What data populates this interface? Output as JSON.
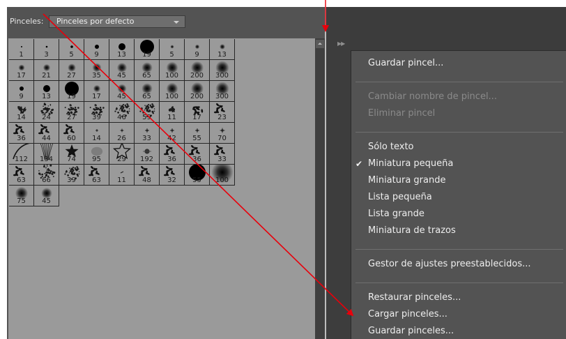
{
  "panel": {
    "label": "Pinceles:",
    "preset_dropdown": "Pinceles por defecto",
    "collapse_icon": "double-chevron-right-icon"
  },
  "brushes": [
    {
      "size": "1",
      "kind": "dot",
      "r": 1
    },
    {
      "size": "3",
      "kind": "dot",
      "r": 1.3
    },
    {
      "size": "5",
      "kind": "dot",
      "r": 1.8
    },
    {
      "size": "9",
      "kind": "dot",
      "r": 3
    },
    {
      "size": "13",
      "kind": "dot",
      "r": 5
    },
    {
      "size": "19",
      "kind": "dot",
      "r": 10
    },
    {
      "size": "5",
      "kind": "soft",
      "r": 2
    },
    {
      "size": "9",
      "kind": "soft",
      "r": 2.5
    },
    {
      "size": "13",
      "kind": "soft",
      "r": 3
    },
    {
      "size": "17",
      "kind": "soft",
      "r": 3.5
    },
    {
      "size": "21",
      "kind": "soft",
      "r": 4
    },
    {
      "size": "27",
      "kind": "soft",
      "r": 4.5
    },
    {
      "size": "35",
      "kind": "soft",
      "r": 5
    },
    {
      "size": "45",
      "kind": "soft",
      "r": 5.5
    },
    {
      "size": "65",
      "kind": "soft",
      "r": 6
    },
    {
      "size": "100",
      "kind": "soft",
      "r": 6.5
    },
    {
      "size": "200",
      "kind": "soft",
      "r": 7
    },
    {
      "size": "300",
      "kind": "soft",
      "r": 7.5
    },
    {
      "size": "9",
      "kind": "dot",
      "r": 3
    },
    {
      "size": "13",
      "kind": "dot",
      "r": 5
    },
    {
      "size": "19",
      "kind": "dot",
      "r": 10
    },
    {
      "size": "17",
      "kind": "soft",
      "r": 4
    },
    {
      "size": "45",
      "kind": "soft",
      "r": 5
    },
    {
      "size": "65",
      "kind": "soft",
      "r": 6
    },
    {
      "size": "100",
      "kind": "soft",
      "r": 6.5
    },
    {
      "size": "200",
      "kind": "soft",
      "r": 7
    },
    {
      "size": "300",
      "kind": "soft",
      "r": 7.5
    },
    {
      "size": "14",
      "kind": "splat",
      "r": 6
    },
    {
      "size": "24",
      "kind": "splat",
      "r": 9
    },
    {
      "size": "27",
      "kind": "splat",
      "r": 10
    },
    {
      "size": "39",
      "kind": "splat",
      "r": 10
    },
    {
      "size": "46",
      "kind": "splat",
      "r": 11
    },
    {
      "size": "59",
      "kind": "splat",
      "r": 11
    },
    {
      "size": "11",
      "kind": "splat",
      "r": 4
    },
    {
      "size": "17",
      "kind": "leafy",
      "r": 8
    },
    {
      "size": "23",
      "kind": "leafy",
      "r": 10
    },
    {
      "size": "36",
      "kind": "leafy",
      "r": 10
    },
    {
      "size": "44",
      "kind": "leafy",
      "r": 10
    },
    {
      "size": "60",
      "kind": "leafy",
      "r": 10
    },
    {
      "size": "14",
      "kind": "star",
      "r": 2
    },
    {
      "size": "26",
      "kind": "star",
      "r": 2.5
    },
    {
      "size": "33",
      "kind": "star",
      "r": 3
    },
    {
      "size": "42",
      "kind": "star",
      "r": 3
    },
    {
      "size": "55",
      "kind": "star",
      "r": 3
    },
    {
      "size": "70",
      "kind": "star",
      "r": 3.5
    },
    {
      "size": "112",
      "kind": "stroke",
      "r": 14
    },
    {
      "size": "134",
      "kind": "grass",
      "r": 14
    },
    {
      "size": "74",
      "kind": "maple",
      "r": 10
    },
    {
      "size": "95",
      "kind": "leaf",
      "r": 9
    },
    {
      "size": "29",
      "kind": "outline-star",
      "r": 12
    },
    {
      "size": "192",
      "kind": "spark",
      "r": 6
    },
    {
      "size": "36",
      "kind": "leafy",
      "r": 10
    },
    {
      "size": "36",
      "kind": "leafy",
      "r": 10
    },
    {
      "size": "33",
      "kind": "leafy",
      "r": 10
    },
    {
      "size": "63",
      "kind": "leafy",
      "r": 10
    },
    {
      "size": "66",
      "kind": "texture",
      "r": 12
    },
    {
      "size": "39",
      "kind": "texture",
      "r": 11
    },
    {
      "size": "63",
      "kind": "leafy",
      "r": 10
    },
    {
      "size": "11",
      "kind": "tiny",
      "r": 1.5
    },
    {
      "size": "48",
      "kind": "leafy",
      "r": 10
    },
    {
      "size": "32",
      "kind": "leafy",
      "r": 10
    },
    {
      "size": "55",
      "kind": "bigdot",
      "r": 12
    },
    {
      "size": "100",
      "kind": "fuzzy",
      "r": 12
    },
    {
      "size": "75",
      "kind": "soft",
      "r": 7
    },
    {
      "size": "45",
      "kind": "soft",
      "r": 6
    }
  ],
  "menu": {
    "items": [
      {
        "label": "Guardar pincel...",
        "enabled": true,
        "checked": false
      },
      {
        "label": "Cambiar nombre de pincel...",
        "enabled": false,
        "checked": false
      },
      {
        "label": "Eliminar pincel",
        "enabled": false,
        "checked": false
      },
      {
        "label": "Sólo texto",
        "enabled": true,
        "checked": false
      },
      {
        "label": "Miniatura pequeña",
        "enabled": true,
        "checked": true
      },
      {
        "label": "Miniatura grande",
        "enabled": true,
        "checked": false
      },
      {
        "label": "Lista pequeña",
        "enabled": true,
        "checked": false
      },
      {
        "label": "Lista grande",
        "enabled": true,
        "checked": false
      },
      {
        "label": "Miniatura de trazos",
        "enabled": true,
        "checked": false
      },
      {
        "label": "Gestor de ajustes preestablecidos...",
        "enabled": true,
        "checked": false
      },
      {
        "label": "Restaurar pinceles...",
        "enabled": true,
        "checked": false
      },
      {
        "label": "Cargar pinceles...",
        "enabled": true,
        "checked": false
      },
      {
        "label": "Guardar pinceles...",
        "enabled": true,
        "checked": false
      }
    ],
    "check_icon": "check-icon"
  },
  "annotations": {
    "color": "#e8000b"
  },
  "colors": {
    "panel": "#535353",
    "grid": "#9a9a9a",
    "menu": "#535353",
    "menu_text": "#eeeeee",
    "menu_disabled": "#8a8a8a"
  }
}
